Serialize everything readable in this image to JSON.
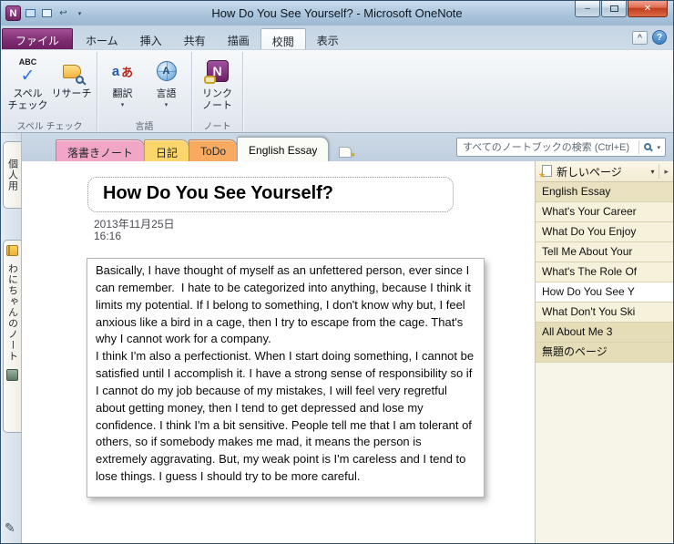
{
  "titlebar": {
    "title": "How Do You See Yourself? - Microsoft OneNote"
  },
  "icons": {
    "onenote_logo": "N",
    "undo": "↩",
    "qat_dropdown": "▾",
    "minimize": "–",
    "close": "✕",
    "ribbon_collapse": "^",
    "help": "?",
    "spell_abc": "ABC",
    "spell_check": "✓",
    "translate_a": "a",
    "translate_kana": "あ",
    "globe_letter": "A",
    "linked_n": "N",
    "dropdown": "▾",
    "new_section_star": "✶",
    "panel_dropdown": "▾",
    "panel_expand": "▸",
    "new_page_star": "★",
    "pencil": "✎"
  },
  "colors": {
    "file_tab_purple": "#7c2b6f",
    "close_button_red": "#c13a1e",
    "section_pink": "#f0a6c4",
    "section_yellow": "#fbd66c",
    "section_orange": "#f8ab60",
    "panel_tan": "#f6f1da"
  },
  "ribbon": {
    "tabs": [
      {
        "label": "ファイル"
      },
      {
        "label": "ホーム"
      },
      {
        "label": "挿入"
      },
      {
        "label": "共有"
      },
      {
        "label": "描画"
      },
      {
        "label": "校閲"
      },
      {
        "label": "表示"
      }
    ],
    "spell_group": {
      "label": "スペル チェック",
      "spell": "スペル\nチェック",
      "research": "リサーチ"
    },
    "language_group": {
      "label": "言語",
      "translate": "翻訳",
      "language": "言語"
    },
    "note_group": {
      "label": "ノート",
      "linked_notes": "リンク\nノート"
    }
  },
  "sectionbar": {
    "tabs": [
      {
        "label": "落書きノート",
        "color": "#f0a6c4"
      },
      {
        "label": "日記",
        "color": "#fbd66c"
      },
      {
        "label": "ToDo",
        "color": "#f8ab60"
      },
      {
        "label": "English Essay",
        "color": "#fcfcf6"
      }
    ],
    "search_placeholder": "すべてのノートブックの検索 (Ctrl+E)"
  },
  "left_rail": {
    "personal": "個人用",
    "notebook": "わにちゃんのノート"
  },
  "page": {
    "title": "How Do You See Yourself?",
    "date": "2013年11月25日",
    "time": "16:16",
    "body": "Basically, I have thought of myself as an unfettered person, ever since I can remember.  I hate to be categorized into anything, because I think it limits my potential. If I belong to something, I don't know why but, I feel anxious like a bird in a cage, then I try to escape from the cage. That's why I cannot work for a company.\nI think I'm also a perfectionist. When I start doing something, I cannot be satisfied until I accomplish it. I have a strong sense of responsibility so if I cannot do my job because of my mistakes, I will feel very regretful about getting money, then I tend to get depressed and lose my confidence. I think I'm a bit sensitive. People tell me that I am tolerant of others, so if somebody makes me mad, it means the person is extremely aggravating. But, my weak point is I'm careless and I tend to lose things. I guess I should try to be more careful."
  },
  "right_panel": {
    "new_page": "新しいページ",
    "pages": [
      {
        "label": "English Essay",
        "variant": "selected"
      },
      {
        "label": "What's Your Career",
        "variant": "normal"
      },
      {
        "label": "What Do You Enjoy",
        "variant": "normal"
      },
      {
        "label": "Tell Me About Your",
        "variant": "normal"
      },
      {
        "label": "What's The Role Of",
        "variant": "normal"
      },
      {
        "label": "How Do You See Y",
        "variant": "current"
      },
      {
        "label": "What Don't You Ski",
        "variant": "normal"
      },
      {
        "label": "All About Me 3",
        "variant": "dark"
      },
      {
        "label": "無題のページ",
        "variant": "dark"
      }
    ]
  }
}
